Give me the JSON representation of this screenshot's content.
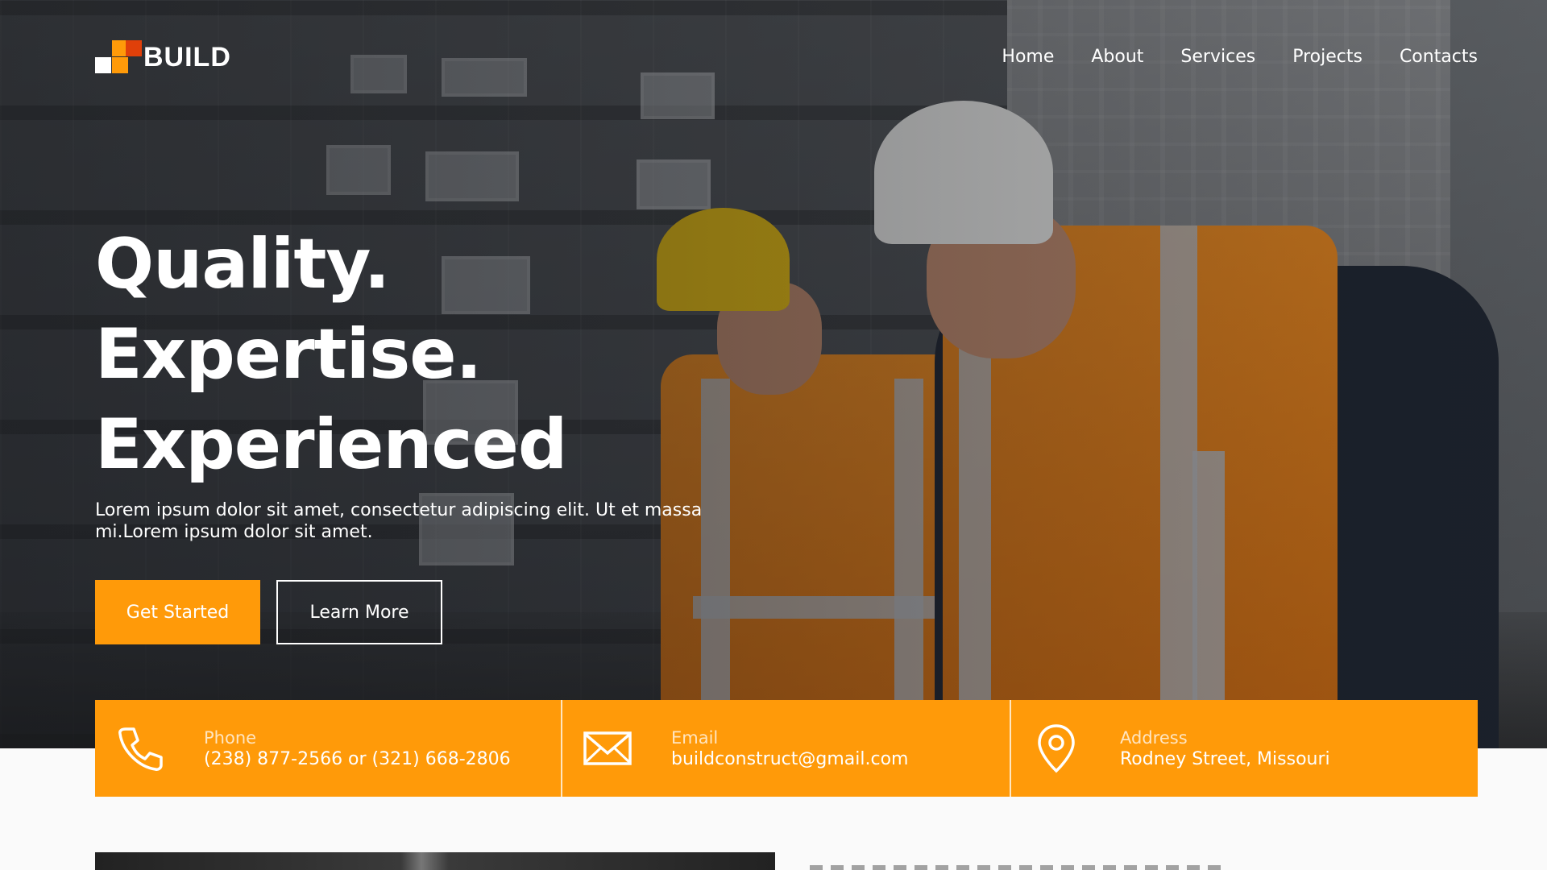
{
  "brand": {
    "name": "BUILD",
    "colors": [
      "#ffffff",
      "#ff9a09",
      "#e0400a"
    ]
  },
  "nav": {
    "items": [
      {
        "label": "Home"
      },
      {
        "label": "About"
      },
      {
        "label": "Services"
      },
      {
        "label": "Projects"
      },
      {
        "label": "Contacts"
      }
    ]
  },
  "hero": {
    "headline": [
      "Quality.",
      "Expertise.",
      "Experienced"
    ],
    "lead": "Lorem ipsum dolor sit amet, consectetur adipiscing elit. Ut et massa mi.Lorem ipsum dolor sit amet.",
    "primary_button": "Get Started",
    "secondary_button": "Learn More"
  },
  "contact": {
    "phone": {
      "label": "Phone",
      "value": "(238) 877-2566 or (321) 668-2806",
      "icon": "phone-icon"
    },
    "email": {
      "label": "Email",
      "value": "buildconstruct@gmail.com",
      "icon": "envelope-icon"
    },
    "address": {
      "label": "Address",
      "value": "Rodney Street, Missouri",
      "icon": "map-pin-icon"
    }
  },
  "theme": {
    "accent": "#ff9a09",
    "text_on_dark": "#ffffff",
    "page_bg": "#fafafa"
  }
}
